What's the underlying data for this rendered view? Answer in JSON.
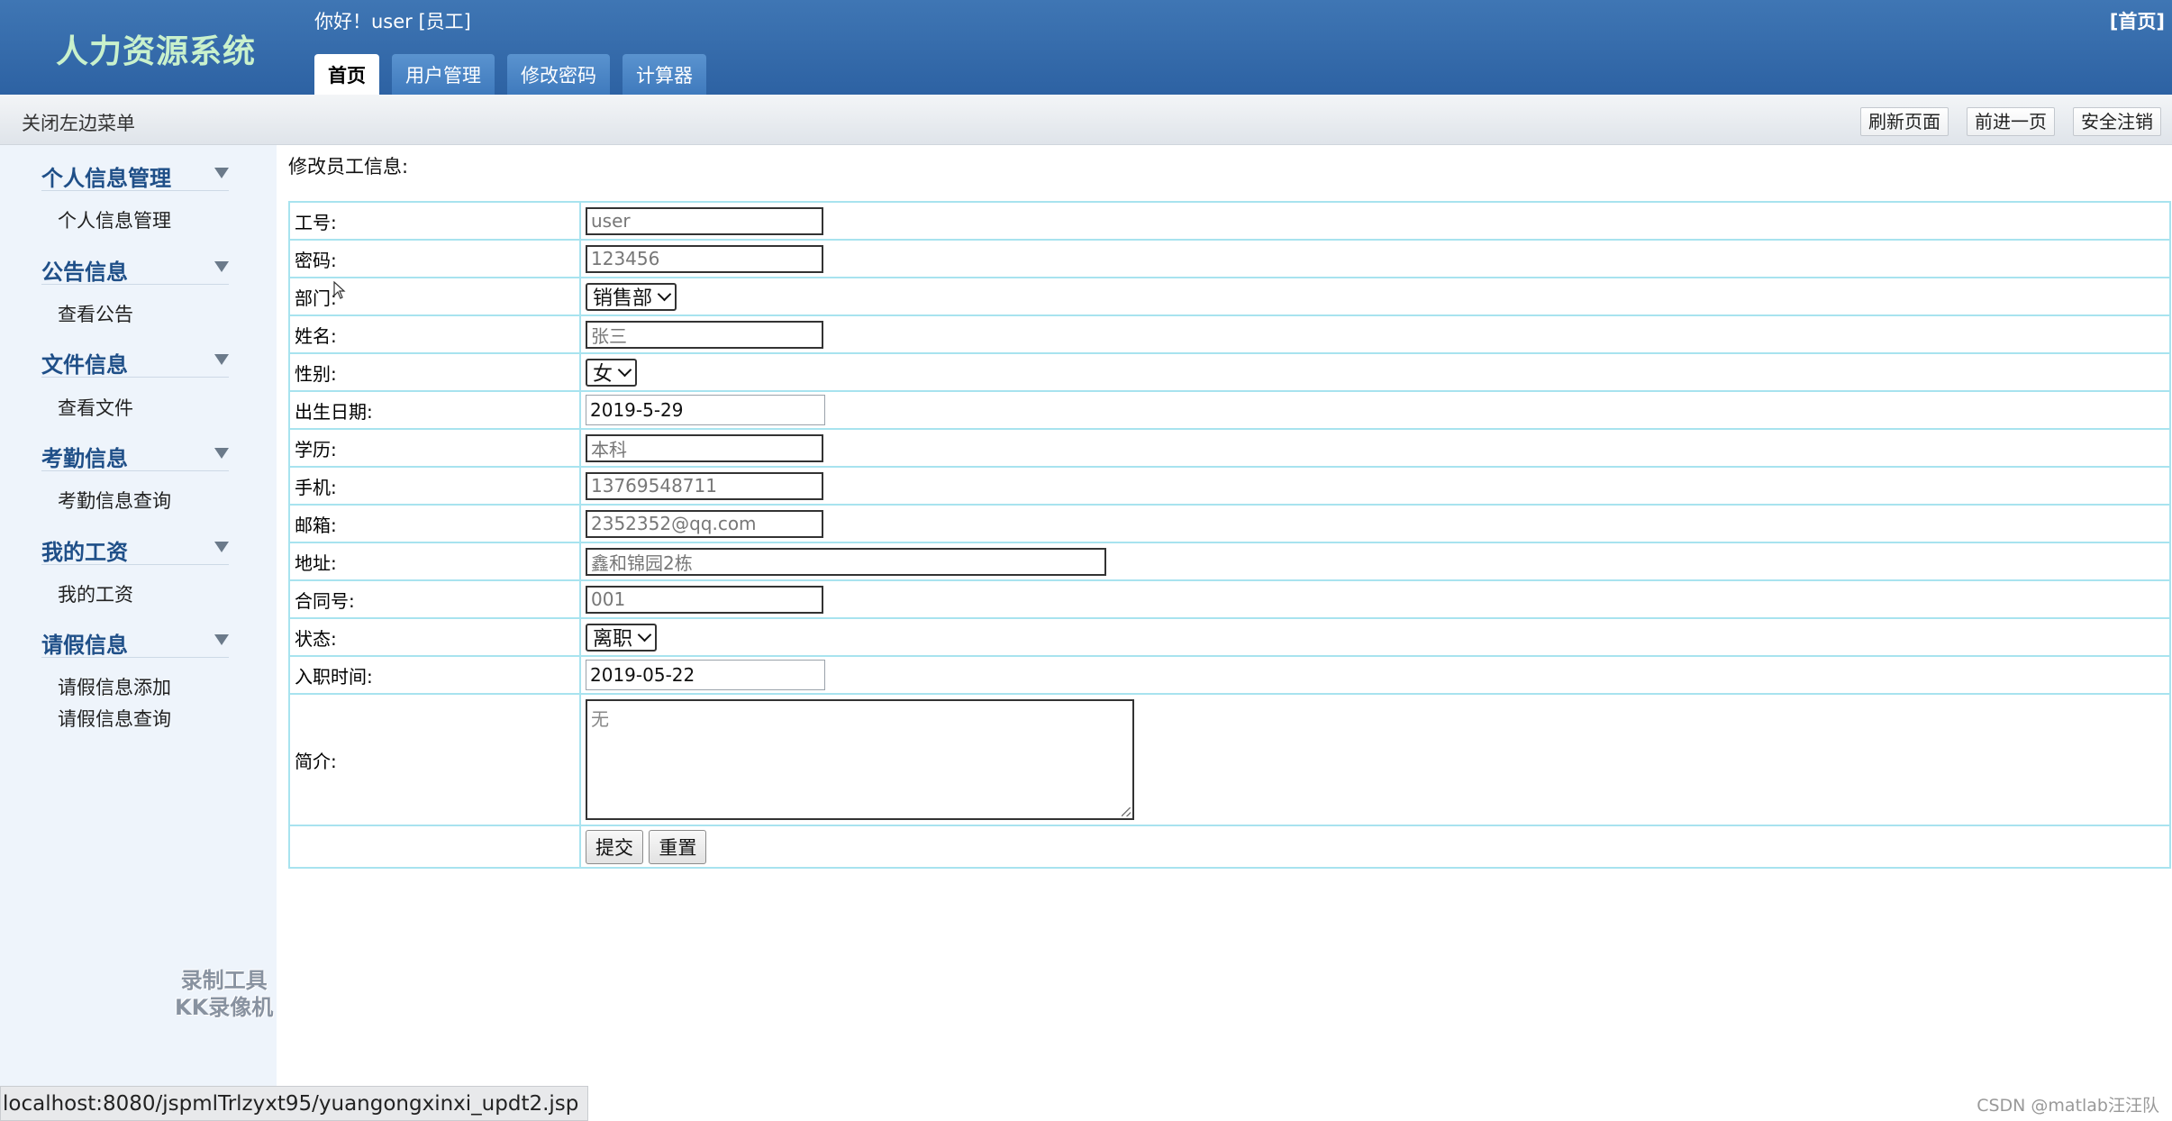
{
  "header": {
    "logo": "人力资源系统",
    "greeting": "你好！user [员工]",
    "home_link": "[首页]",
    "tabs": [
      "首页",
      "用户管理",
      "修改密码",
      "计算器"
    ]
  },
  "subbar": {
    "toggle_menu": "关闭左边菜单",
    "buttons": [
      "刷新页面",
      "前进一页",
      "安全注销"
    ]
  },
  "sidebar": {
    "groups": [
      {
        "title": "个人信息管理",
        "items": [
          "个人信息管理"
        ]
      },
      {
        "title": "公告信息",
        "items": [
          "查看公告"
        ]
      },
      {
        "title": "文件信息",
        "items": [
          "查看文件"
        ]
      },
      {
        "title": "考勤信息",
        "items": [
          "考勤信息查询"
        ]
      },
      {
        "title": "我的工资",
        "items": [
          "我的工资"
        ]
      },
      {
        "title": "请假信息",
        "items": [
          "请假信息添加",
          "请假信息查询"
        ]
      }
    ],
    "watermark": [
      "录制工具",
      "KK录像机"
    ]
  },
  "form": {
    "title": "修改员工信息:",
    "fields": {
      "job_no": {
        "label": "工号:",
        "value": "user"
      },
      "password": {
        "label": "密码:",
        "value": "123456"
      },
      "department": {
        "label": "部门:",
        "value": "销售部"
      },
      "name": {
        "label": "姓名:",
        "value": "张三"
      },
      "gender": {
        "label": "性别:",
        "value": "女"
      },
      "birth_date": {
        "label": "出生日期:",
        "value": "2019-5-29"
      },
      "education": {
        "label": "学历:",
        "value": "本科"
      },
      "phone": {
        "label": "手机:",
        "value": "13769548711"
      },
      "email": {
        "label": "邮箱:",
        "value": "2352352@qq.com"
      },
      "address": {
        "label": "地址:",
        "value": "鑫和锦园2栋"
      },
      "contract_no": {
        "label": "合同号:",
        "value": "001"
      },
      "status": {
        "label": "状态:",
        "value": "离职"
      },
      "hire_date": {
        "label": "入职时间:",
        "value": "2019-05-22"
      },
      "intro": {
        "label": "简介:",
        "value": "无"
      }
    },
    "submit_label": "提交",
    "reset_label": "重置"
  },
  "status_bar": {
    "url": "localhost:8080/jspmlTrlzyxt95/yuangongxinxi_updt2.jsp",
    "credit": "CSDN @matlab汪汪队"
  }
}
